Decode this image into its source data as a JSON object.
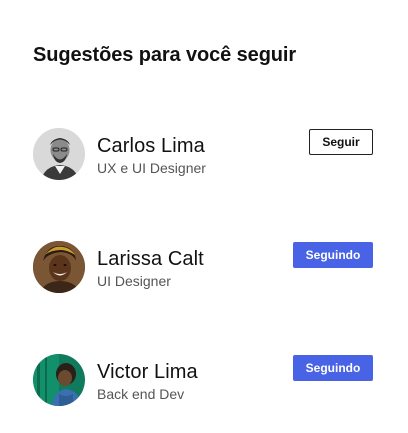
{
  "panel": {
    "title": "Sugestões para você seguir"
  },
  "colors": {
    "accent": "#4863e6",
    "text": "#111111",
    "muted": "#555555"
  },
  "suggestions": [
    {
      "name": "Carlos Lima",
      "role": "UX e UI Designer",
      "button_label": "Seguir",
      "following": false,
      "avatar_icon": "avatar-photo-icon"
    },
    {
      "name": "Larissa Calt",
      "role": "UI Designer",
      "button_label": "Seguindo",
      "following": true,
      "avatar_icon": "avatar-photo-icon"
    },
    {
      "name": "Victor Lima",
      "role": "Back end Dev",
      "button_label": "Seguindo",
      "following": true,
      "avatar_icon": "avatar-photo-icon"
    }
  ]
}
